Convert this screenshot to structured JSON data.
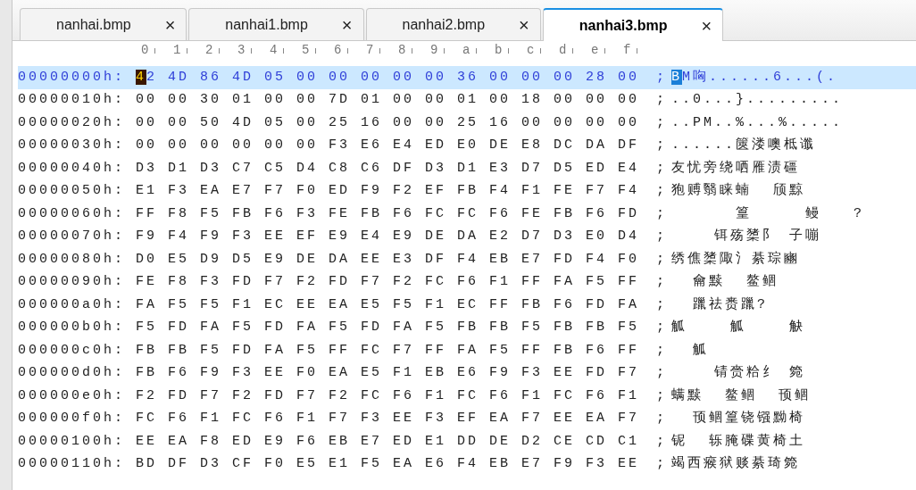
{
  "tabs": [
    {
      "label": "nanhai.bmp",
      "close": "×",
      "selected": false
    },
    {
      "label": "nanhai1.bmp",
      "close": "×",
      "selected": false
    },
    {
      "label": "nanhai2.bmp",
      "close": "×",
      "selected": false
    },
    {
      "label": "nanhai3.bmp",
      "close": "×",
      "selected": true
    }
  ],
  "column_labels": [
    "0",
    "1",
    "2",
    "3",
    "4",
    "5",
    "6",
    "7",
    "8",
    "9",
    "a",
    "b",
    "c",
    "d",
    "e",
    "f"
  ],
  "rows": [
    {
      "offset": "00000000h:",
      "bytes": [
        "42",
        "4D",
        "86",
        "4D",
        "05",
        "00",
        "00",
        "00",
        "00",
        "00",
        "36",
        "00",
        "00",
        "00",
        "28",
        "00"
      ],
      "separator": ";",
      "text": "BM哅......6...(.",
      "selected": true,
      "caret": true
    },
    {
      "offset": "00000010h:",
      "bytes": [
        "00",
        "00",
        "30",
        "01",
        "00",
        "00",
        "7D",
        "01",
        "00",
        "00",
        "01",
        "00",
        "18",
        "00",
        "00",
        "00"
      ],
      "separator": ";",
      "text": "..0...}.........",
      "selected": false,
      "caret": false
    },
    {
      "offset": "00000020h:",
      "bytes": [
        "00",
        "00",
        "50",
        "4D",
        "05",
        "00",
        "25",
        "16",
        "00",
        "00",
        "25",
        "16",
        "00",
        "00",
        "00",
        "00"
      ],
      "separator": ";",
      "text": "..PM..%...%.....",
      "selected": false,
      "caret": false
    },
    {
      "offset": "00000030h:",
      "bytes": [
        "00",
        "00",
        "00",
        "00",
        "00",
        "00",
        "F3",
        "E6",
        "E4",
        "ED",
        "E0",
        "DE",
        "E8",
        "DC",
        "DA",
        "DF"
      ],
      "separator": ";",
      "text": "......篋溇噢柢谶",
      "selected": false,
      "caret": false
    },
    {
      "offset": "00000040h:",
      "bytes": [
        "D3",
        "D1",
        "D3",
        "C7",
        "C5",
        "D4",
        "C8",
        "C6",
        "DF",
        "D3",
        "D1",
        "E3",
        "D7",
        "D5",
        "ED",
        "E4"
      ],
      "separator": ";",
      "text": "友忧旁绕哂雁渍礓",
      "selected": false,
      "caret": false
    },
    {
      "offset": "00000050h:",
      "bytes": [
        "E1",
        "F3",
        "EA",
        "E7",
        "F7",
        "F0",
        "ED",
        "F9",
        "F2",
        "EF",
        "FB",
        "F4",
        "F1",
        "FE",
        "F7",
        "F4"
      ],
      "separator": ";",
      "text": "狍赙翳睐蝻  颀黥",
      "selected": false,
      "caret": false
    },
    {
      "offset": "00000060h:",
      "bytes": [
        "FF",
        "F8",
        "F5",
        "FB",
        "F6",
        "F3",
        "FE",
        "FB",
        "F6",
        "FC",
        "FC",
        "F6",
        "FE",
        "FB",
        "F6",
        "FD"
      ],
      "separator": ";",
      "text": "      篁     鳗   ?",
      "selected": false,
      "caret": false
    },
    {
      "offset": "00000070h:",
      "bytes": [
        "F9",
        "F4",
        "F9",
        "F3",
        "EE",
        "EF",
        "E9",
        "E4",
        "E9",
        "DE",
        "DA",
        "E2",
        "D7",
        "D3",
        "E0",
        "D4"
      ],
      "separator": ";",
      "text": "    铒殇橥阝 子嘣",
      "selected": false,
      "caret": false
    },
    {
      "offset": "00000080h:",
      "bytes": [
        "D0",
        "E5",
        "D9",
        "D5",
        "E9",
        "DE",
        "DA",
        "EE",
        "E3",
        "DF",
        "F4",
        "EB",
        "E7",
        "FD",
        "F4",
        "F0"
      ],
      "separator": ";",
      "text": "绣僬橥陬氵綦琮豳",
      "selected": false,
      "caret": false
    },
    {
      "offset": "00000090h:",
      "bytes": [
        "FE",
        "F8",
        "F3",
        "FD",
        "F7",
        "F2",
        "FD",
        "F7",
        "F2",
        "FC",
        "F6",
        "F1",
        "FF",
        "FA",
        "F5",
        "FF"
      ],
      "separator": ";",
      "text": "  龠黩  鳌鲴",
      "selected": false,
      "caret": false
    },
    {
      "offset": "000000a0h:",
      "bytes": [
        "FA",
        "F5",
        "F5",
        "F1",
        "EC",
        "EE",
        "EA",
        "E5",
        "F5",
        "F1",
        "EC",
        "FF",
        "FB",
        "F6",
        "FD",
        "FA"
      ],
      "separator": ";",
      "text": "  躐祛赉躐?",
      "selected": false,
      "caret": false
    },
    {
      "offset": "000000b0h:",
      "bytes": [
        "F5",
        "FD",
        "FA",
        "F5",
        "FD",
        "FA",
        "F5",
        "FD",
        "FA",
        "F5",
        "FB",
        "FB",
        "F5",
        "FB",
        "FB",
        "F5"
      ],
      "separator": ";",
      "text": "觚    觚    觖",
      "selected": false,
      "caret": false
    },
    {
      "offset": "000000c0h:",
      "bytes": [
        "FB",
        "FB",
        "F5",
        "FD",
        "FA",
        "F5",
        "FF",
        "FC",
        "F7",
        "FF",
        "FA",
        "F5",
        "FF",
        "FB",
        "F6",
        "FF"
      ],
      "separator": ";",
      "text": "  觚",
      "selected": false,
      "caret": false
    },
    {
      "offset": "000000d0h:",
      "bytes": [
        "FB",
        "F6",
        "F9",
        "F3",
        "EE",
        "F0",
        "EA",
        "E5",
        "F1",
        "EB",
        "E6",
        "F9",
        "F3",
        "EE",
        "FD",
        "F7"
      ],
      "separator": ";",
      "text": "    锖赍粭纟 箢",
      "selected": false,
      "caret": false
    },
    {
      "offset": "000000e0h:",
      "bytes": [
        "F2",
        "FD",
        "F7",
        "F2",
        "FD",
        "F7",
        "F2",
        "FC",
        "F6",
        "F1",
        "FC",
        "F6",
        "F1",
        "FC",
        "F6",
        "F1"
      ],
      "separator": ";",
      "text": "螨黩  鳌鲴  顸鲴",
      "selected": false,
      "caret": false
    },
    {
      "offset": "000000f0h:",
      "bytes": [
        "FC",
        "F6",
        "F1",
        "FC",
        "F6",
        "F1",
        "F7",
        "F3",
        "EE",
        "F3",
        "EF",
        "EA",
        "F7",
        "EE",
        "EA",
        "F7"
      ],
      "separator": ";",
      "text": "  顸鲴篁铙镪黝椅",
      "selected": false,
      "caret": false
    },
    {
      "offset": "00000100h:",
      "bytes": [
        "EE",
        "EA",
        "F8",
        "ED",
        "E9",
        "F6",
        "EB",
        "E7",
        "ED",
        "E1",
        "DD",
        "DE",
        "D2",
        "CE",
        "CD",
        "C1"
      ],
      "separator": ";",
      "text": "铌  轹腌碟黄椅土",
      "selected": false,
      "caret": false
    },
    {
      "offset": "00000110h:",
      "bytes": [
        "BD",
        "DF",
        "D3",
        "CF",
        "F0",
        "E5",
        "E1",
        "F5",
        "EA",
        "E6",
        "F4",
        "EB",
        "E7",
        "F9",
        "F3",
        "EE"
      ],
      "separator": ";",
      "text": "竭西瘊狱赕綦琦箢",
      "selected": false,
      "caret": false
    }
  ]
}
